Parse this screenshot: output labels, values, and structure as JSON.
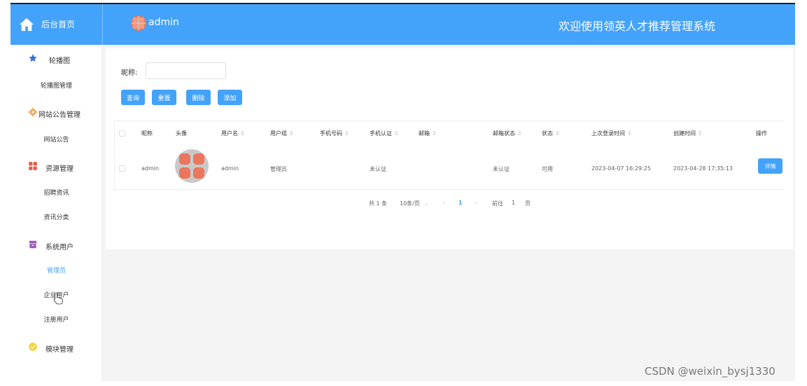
{
  "header": {
    "logo_text": "后台首页",
    "user_name": "admin",
    "system_title": "欢迎使用领英人才推荐管理系统",
    "bg_color": "#43a2f9"
  },
  "sidebar": {
    "groups": [
      {
        "label": "轮播图",
        "icon": "star-icon",
        "items": [
          "轮播图管理"
        ]
      },
      {
        "label": "网站公告管理",
        "icon": "gear-icon",
        "items": [
          "网站公告"
        ]
      },
      {
        "label": "资源管理",
        "icon": "grid-icon",
        "items": [
          "招聘资讯",
          "资讯分类"
        ]
      },
      {
        "label": "系统用户",
        "icon": "archive-icon",
        "items": [
          "管理员",
          "企业用户",
          "注册用户"
        ]
      },
      {
        "label": "模块管理",
        "icon": "badge-icon",
        "items": []
      }
    ],
    "active_item": "管理员"
  },
  "search": {
    "label": "昵称:",
    "value": "",
    "placeholder": ""
  },
  "buttons": {
    "query": "查询",
    "reset": "重置",
    "delete": "删除",
    "add": "添加"
  },
  "table": {
    "columns": [
      "昵称",
      "头像",
      "用户名",
      "用户组",
      "手机号码",
      "手机认证",
      "邮箱",
      "邮箱状态",
      "状态",
      "上次登录时间",
      "创建时间",
      "操作"
    ],
    "rows": [
      {
        "nickname": "admin",
        "username": "admin",
        "group": "管理员",
        "phone": "",
        "phone_auth": "未认证",
        "email": "",
        "email_status": "未认证",
        "status": "可用",
        "last_login": "2023-04-07 16:29:25",
        "created": "2023-04-28 17:35:13",
        "action": "详情"
      }
    ]
  },
  "pagination": {
    "total": "共 1 条",
    "page_size": "10条/页",
    "current": "1",
    "goto_prefix": "前往",
    "goto_value": "1",
    "goto_suffix": "页"
  },
  "watermark": "CSDN @weixin_bysj1330"
}
